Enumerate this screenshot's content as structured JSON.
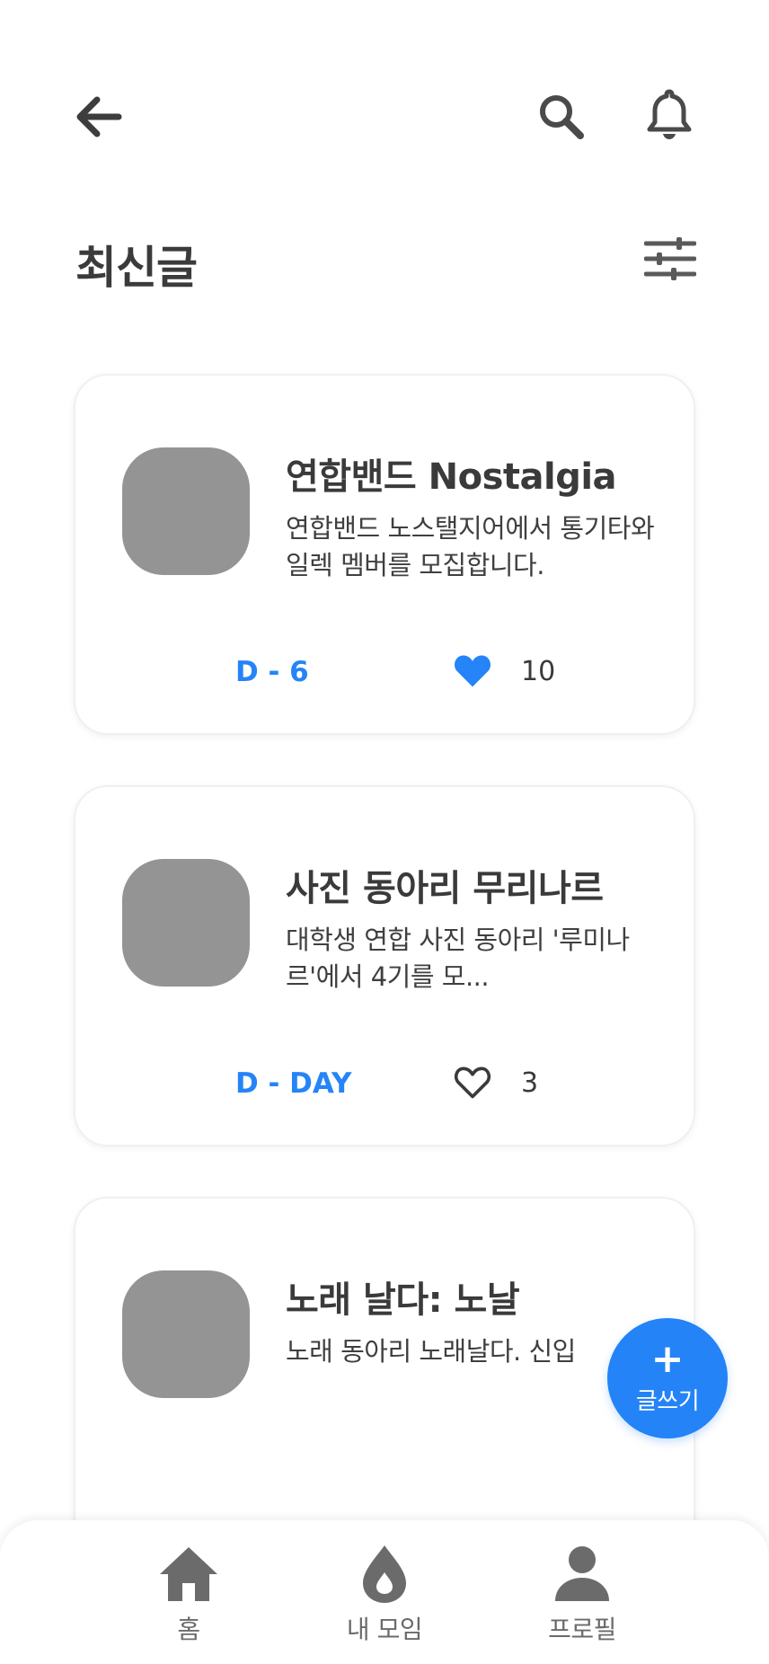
{
  "header": {
    "title": "최신글",
    "icons": [
      "back-arrow-icon",
      "search-icon",
      "bell-icon",
      "filter-sliders-icon"
    ]
  },
  "posts": [
    {
      "title": "연합밴드 Nostalgia",
      "description": "연합밴드 노스탤지어에서 통기타와 일렉 멤버를 모집합니다.",
      "dday": "D - 6",
      "liked": true,
      "likes": "10"
    },
    {
      "title": "사진 동아리 무리나르",
      "description": "대학생 연합 사진 동아리 '루미나르'에서 4기를 모...",
      "dday": "D - DAY",
      "liked": false,
      "likes": "3"
    },
    {
      "title": "노래 날다: 노날",
      "description": "노래 동아리 노래날다. 신입",
      "dday": "",
      "liked": false,
      "likes": ""
    }
  ],
  "fab": {
    "icon": "plus",
    "label": "글쓰기"
  },
  "bottom_nav": {
    "items": [
      {
        "label": "홈",
        "icon": "home-icon"
      },
      {
        "label": "내 모임",
        "icon": "drop-icon"
      },
      {
        "label": "프로필",
        "icon": "person-icon"
      }
    ]
  },
  "colors": {
    "accent": "#2584f7",
    "thumbnail": "#949494",
    "icon": "#4a4a4a",
    "nav_icon": "#6b6b6b"
  }
}
